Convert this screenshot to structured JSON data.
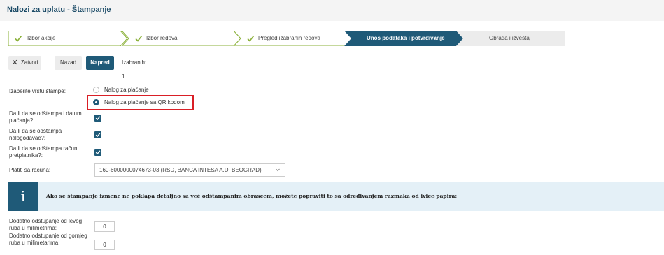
{
  "page": {
    "title": "Nalozi za uplatu - Štampanje"
  },
  "steps": [
    {
      "label": "Izbor akcije",
      "state": "done"
    },
    {
      "label": "Izbor redova",
      "state": "done"
    },
    {
      "label": "Pregled izabranih redova",
      "state": "done"
    },
    {
      "label": "Unos podataka i potvrđivanje",
      "state": "active"
    },
    {
      "label": "Obrada i izveštaj",
      "state": "pending"
    }
  ],
  "toolbar": {
    "close_label": "Zatvori",
    "back_label": "Nazad",
    "next_label": "Napred",
    "selected_label": "Izabranih: 1"
  },
  "form": {
    "print_type_label": "Izaberite vrstu štampe:",
    "print_type_options": [
      "Nalog za plaćanje",
      "Nalog za plaćanje sa QR kodom"
    ],
    "print_type_selected": 1,
    "print_date_label": "Da li da se odštampa i datum plaćanja?:",
    "print_date_checked": true,
    "print_payer_label": "Da li da se odštampa nalogodavac?:",
    "print_payer_checked": true,
    "print_account_label": "Da li da se odštampa račun pretplatnika?:",
    "print_account_checked": true,
    "pay_from_label": "Platiti sa računa:",
    "pay_from_value": "160-6000000074673-03 (RSD, BANCA INTESA A.D. BEOGRAD)"
  },
  "info": {
    "icon": "info-icon",
    "text": "Ako se štampanje izmene ne poklapa detaljno sa već odštampanim obrascem, možete popraviti to sa određivanjem razmaka od ivice papira:"
  },
  "offsets": {
    "left_label": "Dodatno odstupanje od levog ruba u milimetrima:",
    "left_value": "0",
    "top_label": "Dodatno odstupanje od gornjeg ruba u milimetarima:",
    "top_value": "0"
  },
  "colors": {
    "accent": "#1f5a78",
    "step_done_fill": "#ffffff",
    "step_pending_fill": "#ececec",
    "check_green": "#8bb13a",
    "highlight_red": "#d91f26",
    "info_bg": "#e4f0f7"
  }
}
